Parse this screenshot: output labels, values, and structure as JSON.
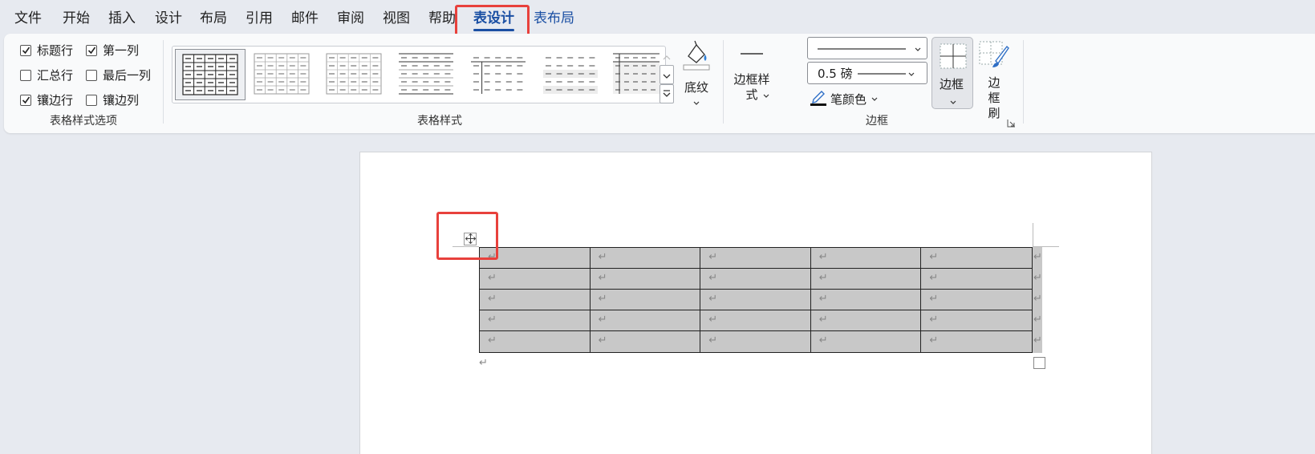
{
  "menu": {
    "items": [
      "文件",
      "开始",
      "插入",
      "设计",
      "布局",
      "引用",
      "邮件",
      "审阅",
      "视图",
      "帮助"
    ],
    "active_tab": "表设计",
    "extra_tab": "表布局"
  },
  "style_options": {
    "checkboxes": [
      {
        "label": "标题行",
        "checked": true
      },
      {
        "label": "第一列",
        "checked": true
      },
      {
        "label": "汇总行",
        "checked": false
      },
      {
        "label": "最后一列",
        "checked": false
      },
      {
        "label": "镶边行",
        "checked": true
      },
      {
        "label": "镶边列",
        "checked": false
      }
    ],
    "group_label": "表格样式选项"
  },
  "table_styles": {
    "group_label": "表格样式",
    "shading_label": "底纹"
  },
  "borders": {
    "border_style_label": "边框样式",
    "pen_weight": "0.5 磅",
    "pen_color_label": "笔颜色",
    "borders_label": "边框",
    "border_painter_label": "边框刷",
    "group_label": "边框"
  },
  "colors": {
    "accent": "#1a4fa3",
    "highlight": "#e8413c",
    "table_fill": "#c8c8c8"
  },
  "document": {
    "table": {
      "rows": 5,
      "cols": 5,
      "cell_mark": "↵"
    },
    "paragraph_mark": "↵",
    "move_handle_icon": "four-arrow-move-icon"
  }
}
